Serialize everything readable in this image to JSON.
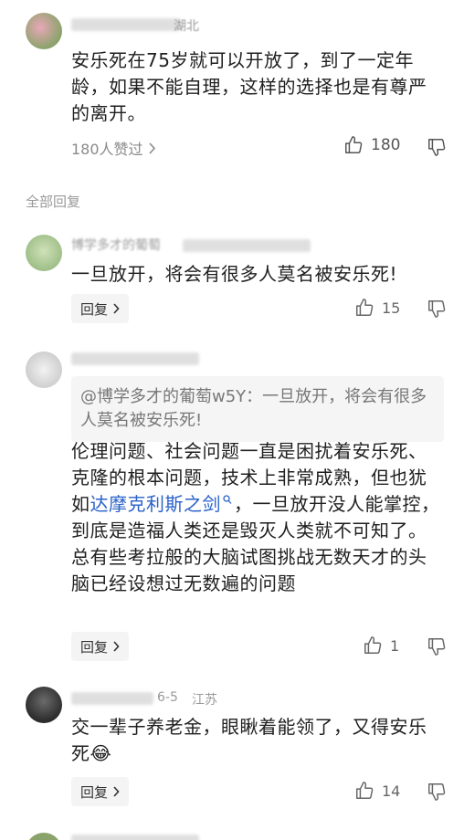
{
  "top_comment": {
    "username_suffix": "湖北",
    "text": "安乐死在75岁就可以开放了，到了一定年龄，如果不能自理，这样的选择也是有尊严的离开。",
    "likes_summary": "180人赞过",
    "like_count": "180"
  },
  "section": {
    "title": "全部回复"
  },
  "replies": [
    {
      "username": "博学多才的葡萄",
      "text": "一旦放开，将会有很多人莫名被安乐死!",
      "reply_label": "回复",
      "like_count": "15"
    },
    {
      "quote": "@博学多才的葡萄w5Y：一旦放开，将会有很多人莫名被安乐死!",
      "text_before_link": "伦理问题、社会问题一直是困扰着安乐死、克隆的根本问题，技术上非常成熟，但也犹如",
      "link_text": "达摩克利斯之剑",
      "text_after_link": "，一旦放开没人能掌控，到底是造福人类还是毁灭人类就不可知了。总有些考拉般的大脑试图挑战无数天才的头脑已经设想过无数遍的问题",
      "reply_label": "回复",
      "like_count": "1"
    },
    {
      "date": "6-5",
      "location": "江苏",
      "text": "交一辈子养老金，眼瞅着能领了，又得安乐死",
      "emoji": "😂",
      "reply_label": "回复",
      "like_count": "14"
    }
  ],
  "colors": {
    "link": "#2a62c9",
    "meta": "#8a8a8a",
    "button_bg": "#f4f4f4"
  }
}
